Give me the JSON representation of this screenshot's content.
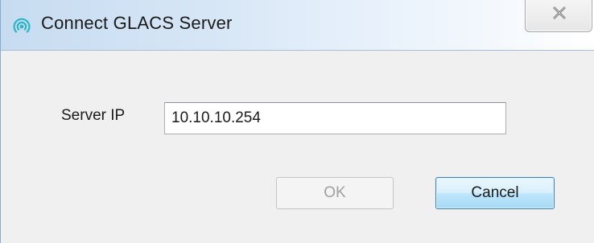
{
  "window": {
    "title": "Connect GLACS Server",
    "icon": "wifi-signal-icon",
    "close_glyph": "close-icon"
  },
  "form": {
    "server_ip_label": "Server IP",
    "server_ip_value": "10.10.10.254"
  },
  "buttons": {
    "ok_label": "OK",
    "ok_enabled": false,
    "cancel_label": "Cancel"
  },
  "colors": {
    "accent": "#3c7fb1",
    "icon": "#2bb5c5"
  }
}
